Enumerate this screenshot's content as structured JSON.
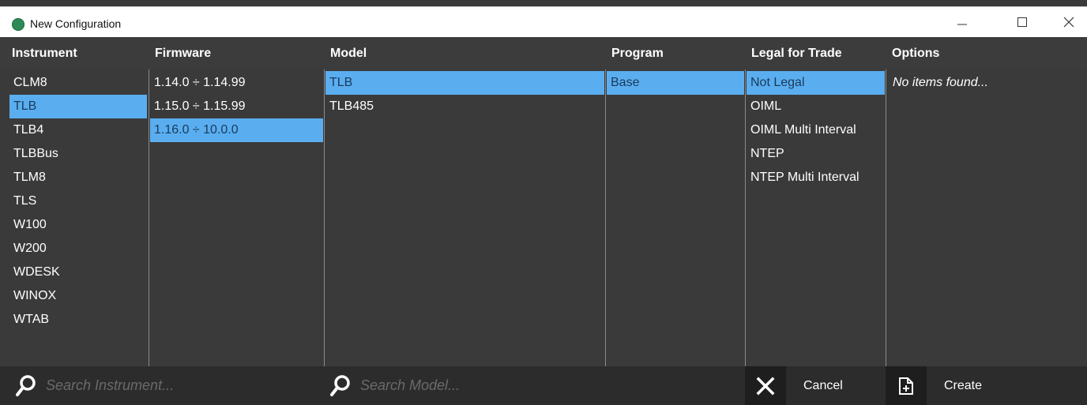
{
  "window": {
    "title": "New Configuration",
    "accent_color": "#2e8b57"
  },
  "headers": {
    "instrument": "Instrument",
    "firmware": "Firmware",
    "model": "Model",
    "program": "Program",
    "legal": "Legal for Trade",
    "options": "Options"
  },
  "instruments": [
    "CLM8",
    "TLB",
    "TLB4",
    "TLBBus",
    "TLM8",
    "TLS",
    "W100",
    "W200",
    "WDESK",
    "WINOX",
    "WTAB"
  ],
  "instrument_selected": "TLB",
  "firmware": [
    "1.14.0 ÷ 1.14.99",
    "1.15.0 ÷ 1.15.99",
    "1.16.0 ÷ 10.0.0"
  ],
  "firmware_selected": "1.16.0 ÷ 10.0.0",
  "models": [
    "TLB",
    "TLB485"
  ],
  "model_selected": "TLB",
  "programs": [
    "Base"
  ],
  "program_selected": "Base",
  "legal": [
    "Not Legal",
    "OIML",
    "OIML Multi Interval",
    "NTEP",
    "NTEP Multi Interval"
  ],
  "legal_selected": "Not Legal",
  "options": {
    "empty_text": "No items found..."
  },
  "bottom": {
    "search_instrument_placeholder": "Search Instrument...",
    "search_model_placeholder": "Search Model...",
    "cancel_label": "Cancel",
    "create_label": "Create"
  },
  "colors": {
    "selection": "#5aaef0",
    "background": "#3a3a3a"
  }
}
